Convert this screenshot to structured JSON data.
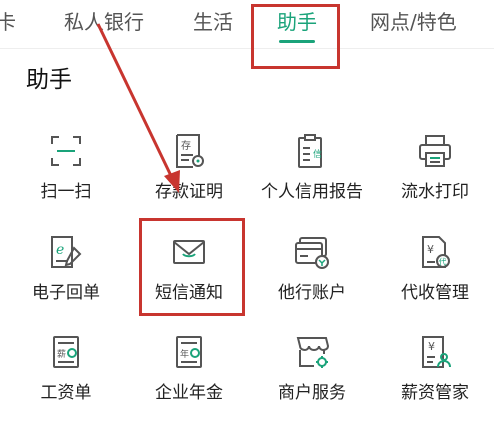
{
  "tabs": [
    {
      "label": "卡",
      "active": false
    },
    {
      "label": "私人银行",
      "active": false
    },
    {
      "label": "生活",
      "active": false
    },
    {
      "label": "助手",
      "active": true
    },
    {
      "label": "网点/特色",
      "active": false
    }
  ],
  "section": {
    "title": "助手"
  },
  "services": [
    {
      "label": "扫一扫",
      "icon": "scan-icon"
    },
    {
      "label": "存款证明",
      "icon": "deposit-certificate-icon",
      "glyph": "存"
    },
    {
      "label": "个人信用报告",
      "icon": "credit-report-icon",
      "glyph": "信"
    },
    {
      "label": "流水打印",
      "icon": "printer-icon"
    },
    {
      "label": "电子回单",
      "icon": "e-receipt-icon",
      "glyph": "e"
    },
    {
      "label": "短信通知",
      "icon": "sms-envelope-icon"
    },
    {
      "label": "他行账户",
      "icon": "other-bank-card-icon"
    },
    {
      "label": "代收管理",
      "icon": "collection-icon",
      "glyph": "¥",
      "glyph2": "代"
    },
    {
      "label": "工资单",
      "icon": "payslip-icon",
      "glyph": "薪"
    },
    {
      "label": "企业年金",
      "icon": "annuity-icon",
      "glyph": "年"
    },
    {
      "label": "商户服务",
      "icon": "merchant-store-icon"
    },
    {
      "label": "薪资管家",
      "icon": "salary-manager-icon",
      "glyph": "¥"
    }
  ],
  "colors": {
    "accent": "#1aa37a",
    "annotation": "#c8352f",
    "icon": "#555555"
  }
}
